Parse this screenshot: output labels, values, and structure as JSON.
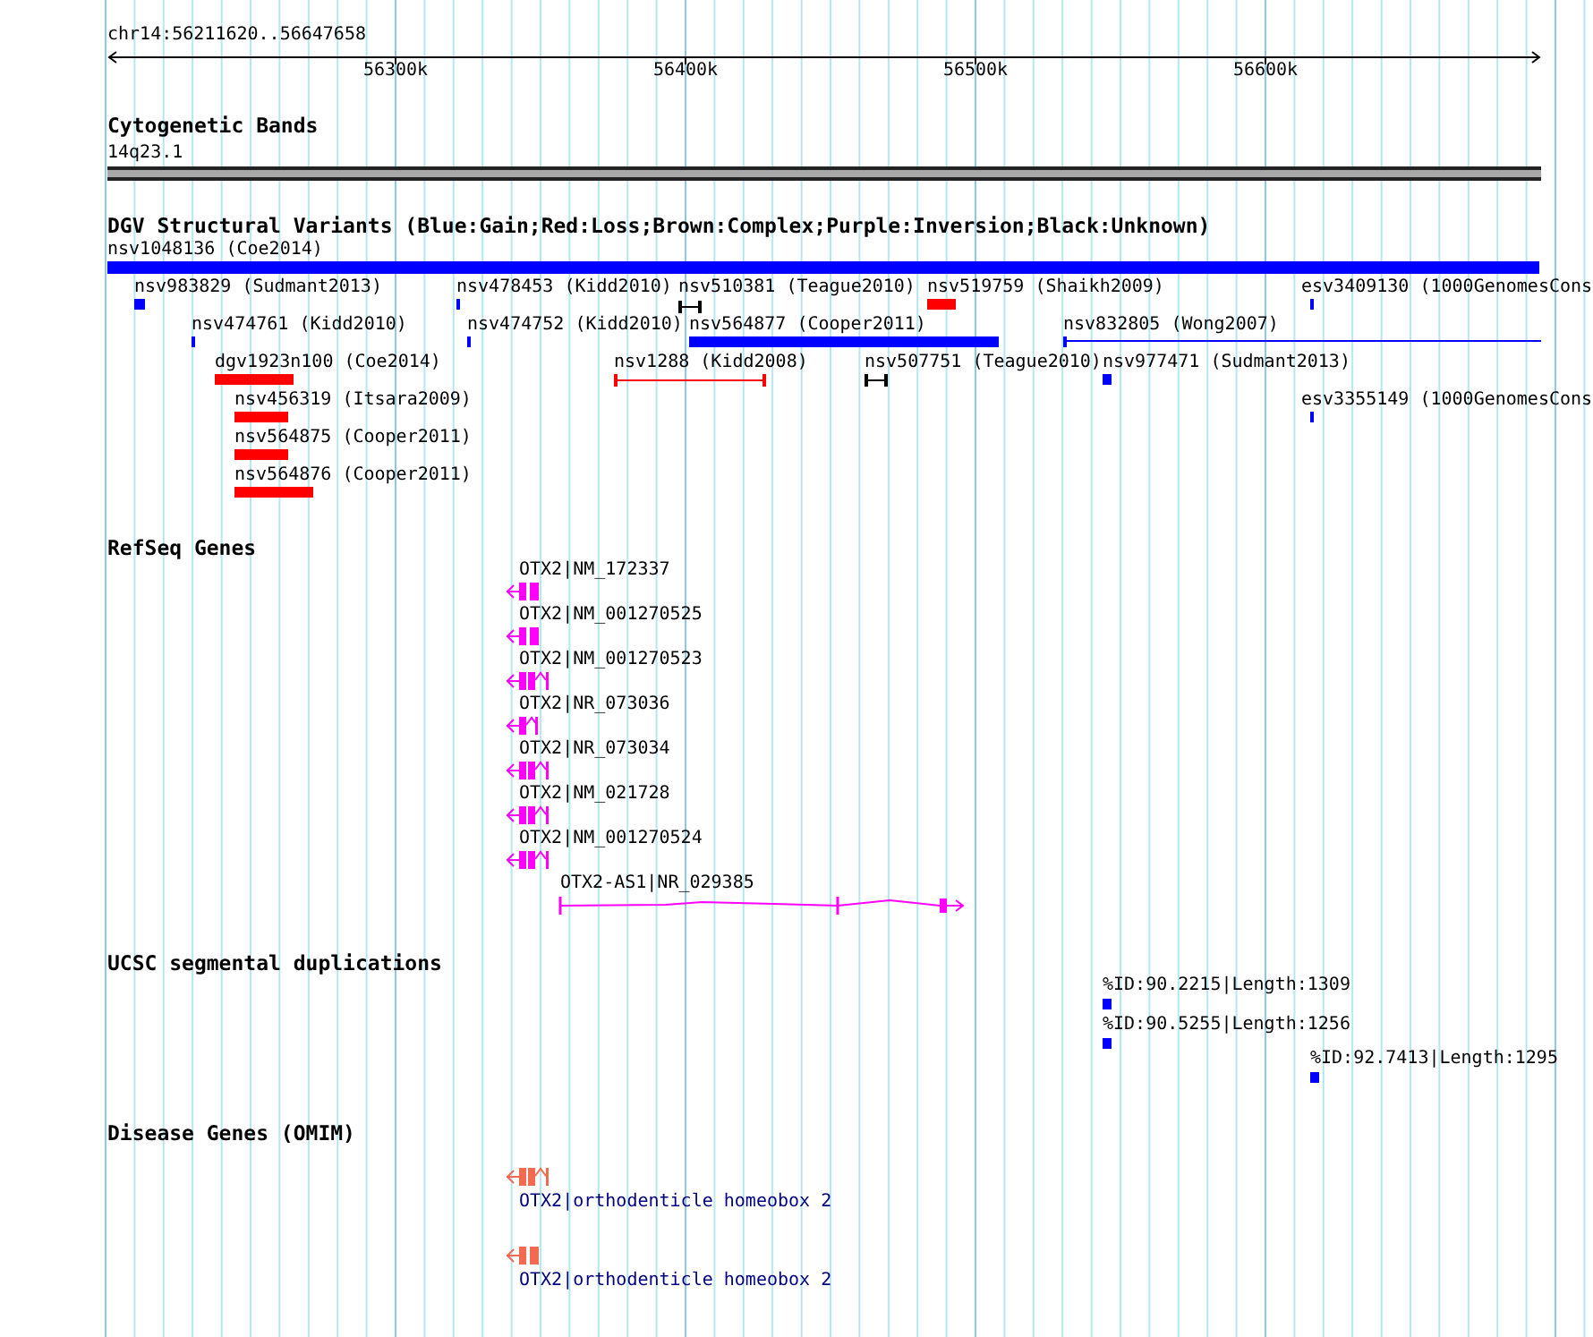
{
  "ruler": {
    "position": "chr14:56211620..56647658",
    "ticks": [
      "56300k",
      "56400k",
      "56500k",
      "56600k"
    ]
  },
  "tracks": [
    {
      "kind": "cytoband",
      "title": "Cytogenetic Bands",
      "bands": [
        {
          "label": "14q23.1"
        }
      ]
    },
    {
      "kind": "variants",
      "title": "DGV Structural Variants (Blue:Gain;Red:Loss;Brown:Complex;Purple:Inversion;Black:Unknown)",
      "features": [
        {
          "label": "nsv1048136 (Coe2014)",
          "color": "#0000ff",
          "kind": "block"
        },
        {
          "label": "nsv983829 (Sudmant2013)",
          "color": "#0000ff",
          "kind": "block"
        },
        {
          "label": "nsv478453 (Kidd2010)",
          "color": "#0000ff",
          "kind": "block"
        },
        {
          "label": "nsv510381 (Teague2010)",
          "color": "#000000",
          "kind": "interval"
        },
        {
          "label": "nsv519759 (Shaikh2009)",
          "color": "#ff0000",
          "kind": "block"
        },
        {
          "label": "esv3409130 (1000GenomesCons",
          "color": "#0000ff",
          "kind": "block"
        },
        {
          "label": "nsv474761 (Kidd2010)",
          "color": "#0000ff",
          "kind": "block"
        },
        {
          "label": "nsv474752 (Kidd2010)",
          "color": "#0000ff",
          "kind": "block"
        },
        {
          "label": "nsv564877 (Cooper2011)",
          "color": "#0000ff",
          "kind": "block"
        },
        {
          "label": "nsv832805 (Wong2007)",
          "color": "#0000ff",
          "kind": "line"
        },
        {
          "label": "dgv1923n100 (Coe2014)",
          "color": "#ff0000",
          "kind": "block"
        },
        {
          "label": "nsv1288 (Kidd2008)",
          "color": "#ff0000",
          "kind": "interval"
        },
        {
          "label": "nsv507751 (Teague2010)",
          "color": "#000000",
          "kind": "interval"
        },
        {
          "label": "nsv977471 (Sudmant2013)",
          "color": "#0000ff",
          "kind": "block"
        },
        {
          "label": "nsv456319 (Itsara2009)",
          "color": "#ff0000",
          "kind": "block"
        },
        {
          "label": "esv3355149 (1000GenomesCons",
          "color": "#0000ff",
          "kind": "block"
        },
        {
          "label": "nsv564875 (Cooper2011)",
          "color": "#ff0000",
          "kind": "block"
        },
        {
          "label": "nsv564876 (Cooper2011)",
          "color": "#ff0000",
          "kind": "block"
        }
      ]
    },
    {
      "kind": "genes",
      "title": "RefSeq Genes",
      "features": [
        {
          "label": "OTX2|NM_172337",
          "reverse": true
        },
        {
          "label": "OTX2|NM_001270525",
          "reverse": true
        },
        {
          "label": "OTX2|NM_001270523",
          "reverse": true
        },
        {
          "label": "OTX2|NR_073036",
          "reverse": true
        },
        {
          "label": "OTX2|NR_073034",
          "reverse": true
        },
        {
          "label": "OTX2|NM_021728",
          "reverse": true
        },
        {
          "label": "OTX2|NM_001270524",
          "reverse": true
        },
        {
          "label": "OTX2-AS1|NR_029385",
          "reverse": false
        }
      ]
    },
    {
      "kind": "duplications",
      "title": "UCSC segmental duplications",
      "features": [
        {
          "label": "%ID:90.2215|Length:1309"
        },
        {
          "label": "%ID:90.5255|Length:1256"
        },
        {
          "label": "%ID:92.7413|Length:1295"
        }
      ]
    },
    {
      "kind": "disease",
      "title": "Disease Genes (OMIM)",
      "features": [
        {
          "label": "OTX2|orthodenticle homeobox 2",
          "reverse": true
        },
        {
          "label": "OTX2|orthodenticle homeobox 2",
          "reverse": true
        }
      ]
    }
  ]
}
